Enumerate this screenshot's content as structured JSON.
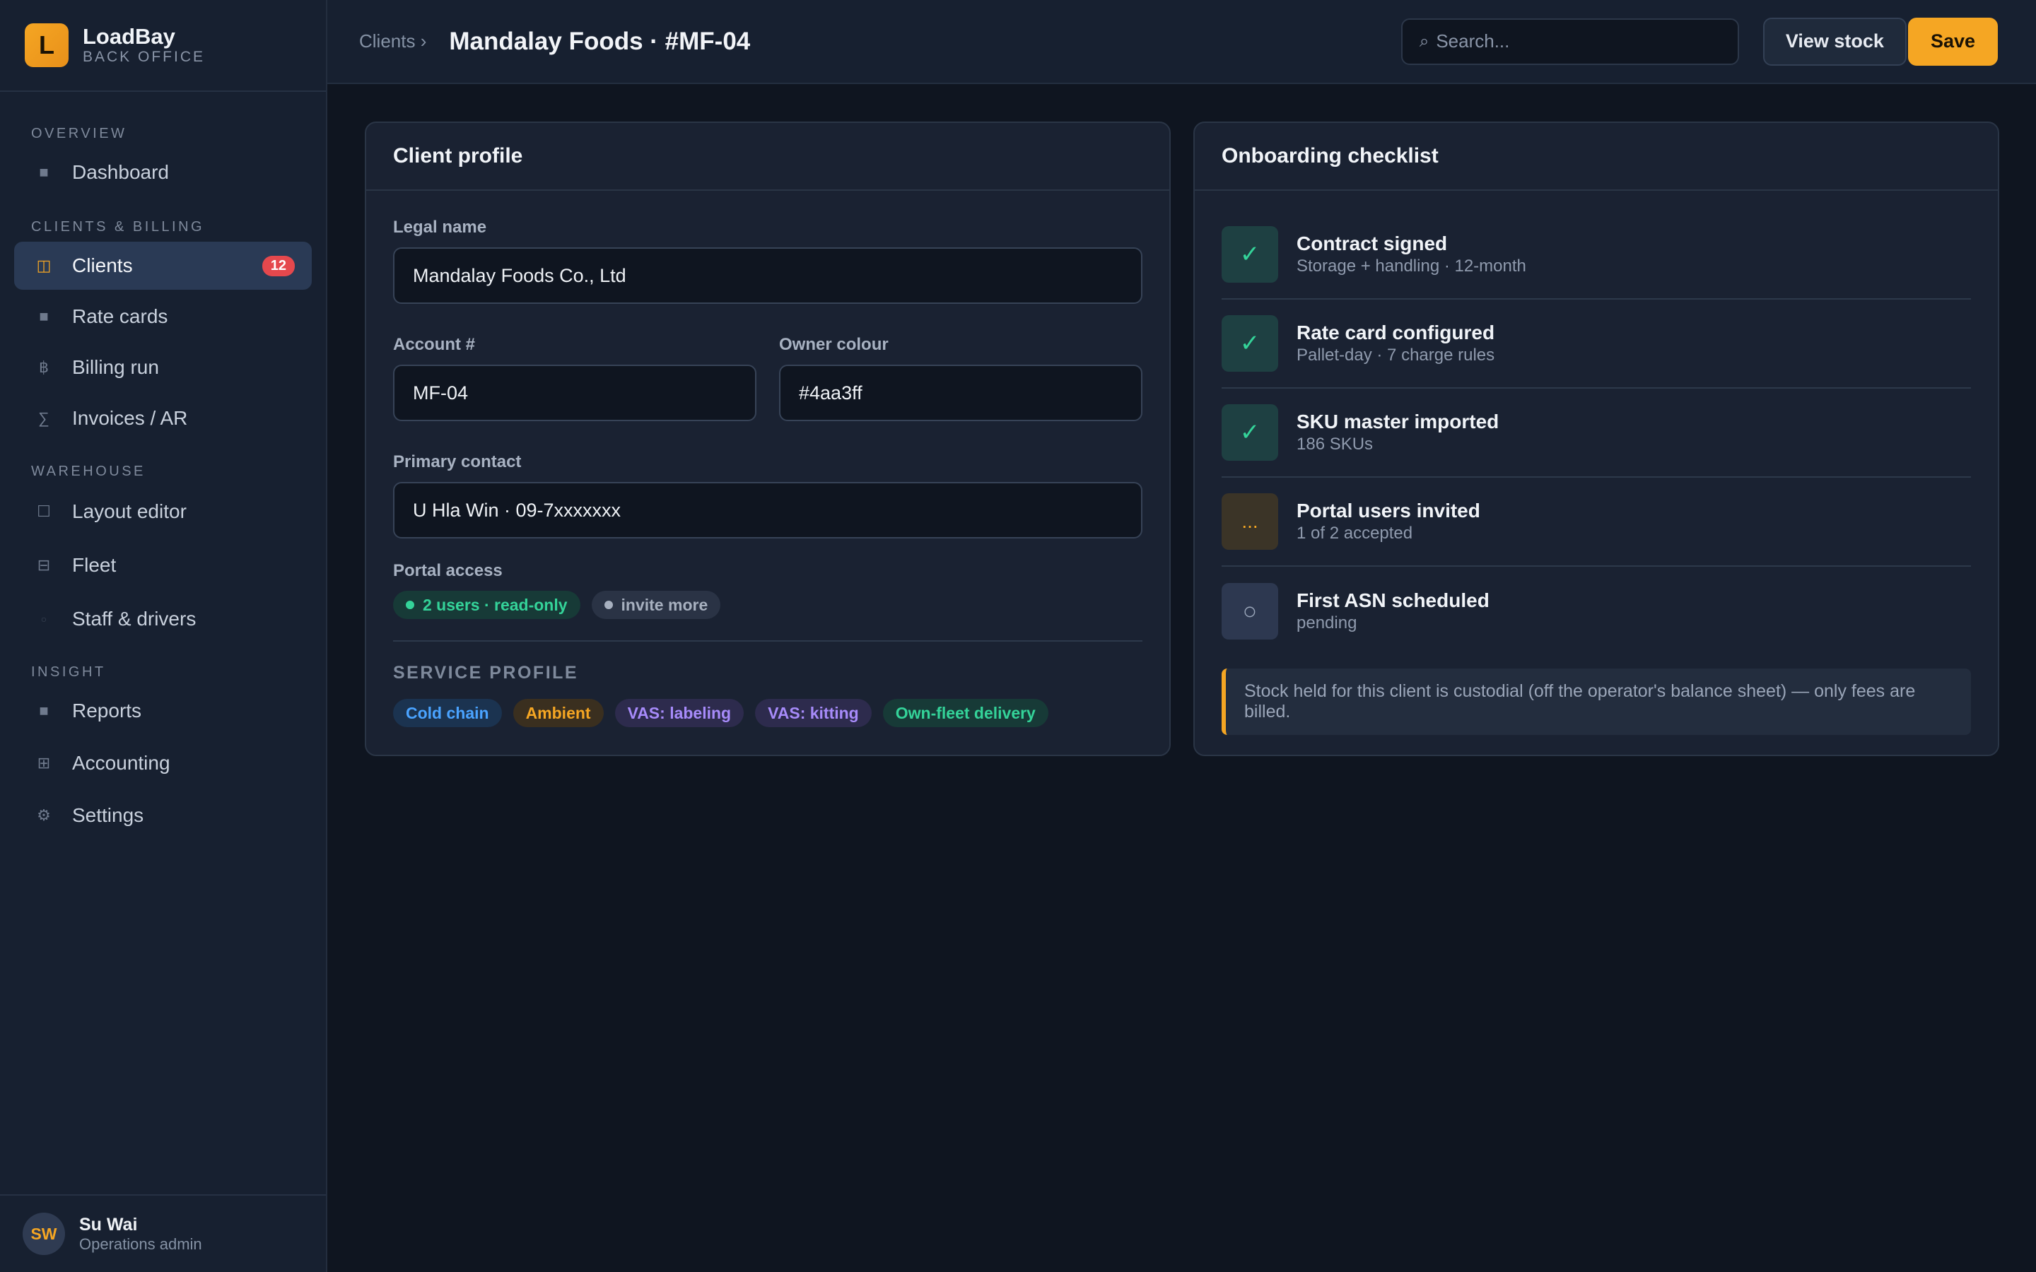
{
  "app": {
    "logo_letter": "L",
    "name": "LoadBay",
    "subtitle": "BACK OFFICE"
  },
  "sidebar": {
    "sections": [
      {
        "title": "OVERVIEW",
        "items": [
          {
            "label": "Dashboard",
            "icon": "dashboard-icon",
            "glyph": "■"
          }
        ]
      },
      {
        "title": "CLIENTS & BILLING",
        "items": [
          {
            "label": "Clients",
            "icon": "clients-icon",
            "glyph": "◫",
            "badge": "12",
            "active": true
          },
          {
            "label": "Rate cards",
            "icon": "rate-cards-icon",
            "glyph": "■"
          },
          {
            "label": "Billing run",
            "icon": "billing-icon",
            "glyph": "฿"
          },
          {
            "label": "Invoices / AR",
            "icon": "invoices-icon",
            "glyph": "∑"
          }
        ]
      },
      {
        "title": "WAREHOUSE",
        "items": [
          {
            "label": "Layout editor",
            "icon": "layout-icon",
            "glyph": "☐"
          },
          {
            "label": "Fleet",
            "icon": "fleet-icon",
            "glyph": "⊟"
          },
          {
            "label": "Staff & drivers",
            "icon": "staff-icon",
            "glyph": "○"
          }
        ]
      },
      {
        "title": "INSIGHT",
        "items": [
          {
            "label": "Reports",
            "icon": "reports-icon",
            "glyph": "■"
          },
          {
            "label": "Accounting",
            "icon": "accounting-icon",
            "glyph": "⊞"
          },
          {
            "label": "Settings",
            "icon": "settings-icon",
            "glyph": "⚙"
          }
        ]
      }
    ]
  },
  "user": {
    "initials": "SW",
    "name": "Su Wai",
    "role": "Operations admin"
  },
  "header": {
    "breadcrumb": "Clients ›",
    "title": "Mandalay Foods · #MF-04",
    "search_placeholder": "Search...",
    "search_glyph": "⌕",
    "view_stock_label": "View stock",
    "save_label": "Save"
  },
  "profile": {
    "title": "Client profile",
    "legal_name_label": "Legal name",
    "legal_name": "Mandalay Foods Co., Ltd",
    "account_label": "Account #",
    "account": "MF-04",
    "owner_colour_label": "Owner colour",
    "owner_colour": "#4aa3ff",
    "contact_label": "Primary contact",
    "contact": "U Hla Win · 09-7xxxxxxx",
    "portal_label": "Portal access",
    "portal_users": "2 users · read-only",
    "portal_invite": "invite more",
    "service_title": "SERVICE PROFILE",
    "service_tags": [
      {
        "label": "Cold chain",
        "color": "blue"
      },
      {
        "label": "Ambient",
        "color": "amber"
      },
      {
        "label": "VAS: labeling",
        "color": "purple"
      },
      {
        "label": "VAS: kitting",
        "color": "purple"
      },
      {
        "label": "Own-fleet delivery",
        "color": "teal"
      }
    ]
  },
  "onboarding": {
    "title": "Onboarding checklist",
    "items": [
      {
        "title": "Contract signed",
        "sub": "Storage + handling · 12-month",
        "state": "done",
        "glyph": "✓"
      },
      {
        "title": "Rate card configured",
        "sub": "Pallet-day · 7 charge rules",
        "state": "done",
        "glyph": "✓"
      },
      {
        "title": "SKU master imported",
        "sub": "186 SKUs",
        "state": "done",
        "glyph": "✓"
      },
      {
        "title": "Portal users invited",
        "sub": "1 of 2 accepted",
        "state": "pending",
        "glyph": "..."
      },
      {
        "title": "First ASN scheduled",
        "sub": "pending",
        "state": "todo",
        "glyph": "○"
      }
    ],
    "note": "Stock held for this client is custodial (off the operator's balance sheet) — only fees are billed."
  },
  "colors": {
    "accent": "#f5a623",
    "success": "#34d399",
    "danger": "#e5484d",
    "background": "#0f1520"
  }
}
